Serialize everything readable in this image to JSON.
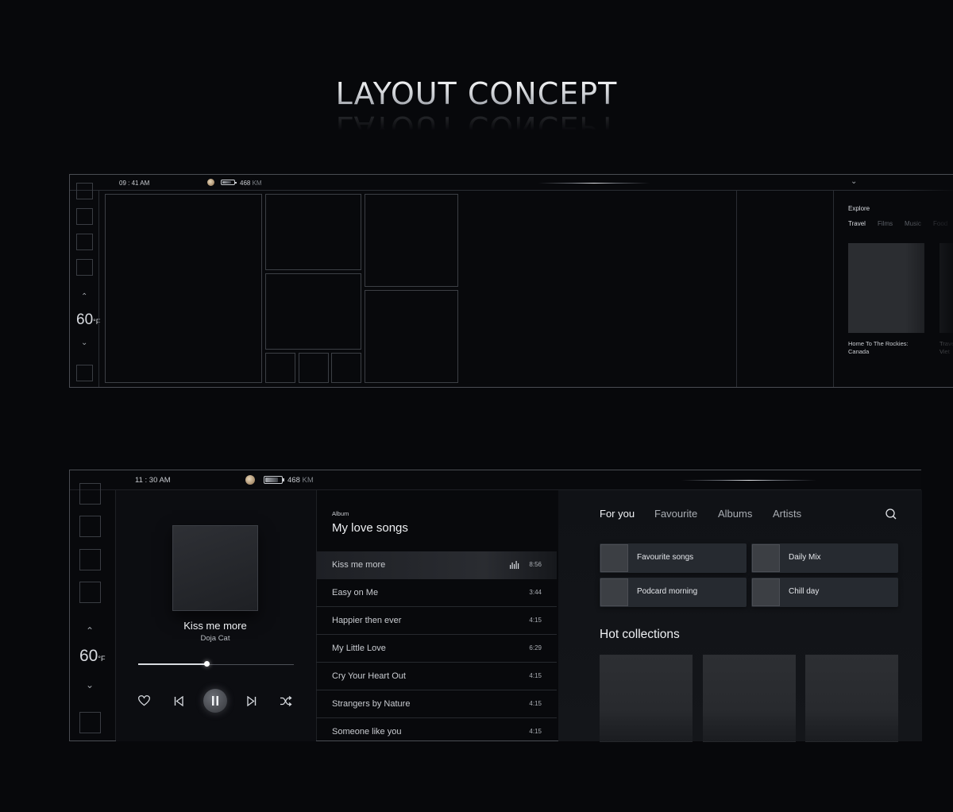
{
  "title": "LAYOUT CONCEPT",
  "frame1": {
    "time": "09 : 41 AM",
    "range": "468",
    "range_unit": "KM",
    "temperature": "60",
    "temp_unit": "°F",
    "explore": {
      "title": "Explore",
      "tabs": [
        "Travel",
        "Films",
        "Music",
        "Food"
      ],
      "active_tab": "Travel",
      "cards": [
        {
          "caption_line1": "Home To The Rockies:",
          "caption_line2": "Canada"
        },
        {
          "caption_line1": "Trave",
          "caption_line2": "Viet"
        }
      ]
    }
  },
  "frame2": {
    "time": "11 : 30 AM",
    "range": "468",
    "range_unit": "KM",
    "temperature": "60",
    "temp_unit": "°F",
    "player": {
      "song": "Kiss me more",
      "artist": "Doja Cat",
      "progress": 0.44
    },
    "album": {
      "label": "Album",
      "name": "My love songs",
      "tracks": [
        {
          "name": "Kiss me more",
          "time": "8:56"
        },
        {
          "name": "Easy on Me",
          "time": "3:44"
        },
        {
          "name": "Happier then ever",
          "time": "4:15"
        },
        {
          "name": "My Little Love",
          "time": "6:29"
        },
        {
          "name": "Cry Your Heart Out",
          "time": "4:15"
        },
        {
          "name": "Strangers by Nature",
          "time": "4:15"
        },
        {
          "name": "Someone like you",
          "time": "4:15"
        }
      ],
      "playing_index": 0
    },
    "library": {
      "tabs": [
        "For you",
        "Favourite",
        "Albums",
        "Artists"
      ],
      "active_tab": "For you",
      "playlists": [
        "Favourite songs",
        "Daily Mix",
        "Podcard morning",
        "Chill day"
      ],
      "hot_title": "Hot collections"
    }
  },
  "icons": {
    "search": "search-icon",
    "heart": "heart-icon",
    "prev": "skip-previous-icon",
    "pause": "pause-icon",
    "next": "skip-next-icon",
    "shuffle": "shuffle-icon"
  }
}
